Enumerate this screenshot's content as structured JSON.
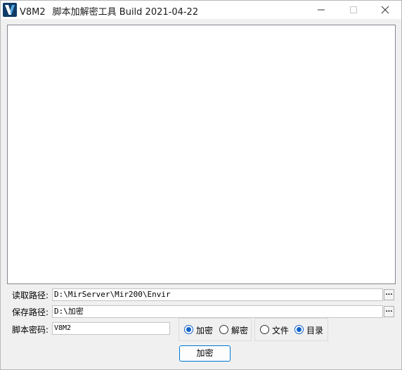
{
  "window": {
    "app_name": "V8M2",
    "title": "脚本加解密工具 Build 2021-04-22",
    "icon_letter": "V"
  },
  "fields": {
    "read_path": {
      "label": "读取路径:",
      "value": "D:\\MirServer\\Mir200\\Envir",
      "browse_label": "..."
    },
    "save_path": {
      "label": "保存路径:",
      "value": "D:\\加密",
      "browse_label": "..."
    },
    "script_password": {
      "label": "脚本密码:",
      "value": "V8M2"
    }
  },
  "mode": {
    "options": [
      {
        "label": "加密",
        "checked": true
      },
      {
        "label": "解密",
        "checked": false
      }
    ]
  },
  "target": {
    "options": [
      {
        "label": "文件",
        "checked": false
      },
      {
        "label": "目录",
        "checked": true
      }
    ]
  },
  "action": {
    "label": "加密"
  },
  "colors": {
    "accent": "#0f62c7",
    "button_border": "#0078d7",
    "icon_bg": "#0f3b66"
  },
  "icons": {
    "app": "v-logo-icon",
    "minimize": "minimize-icon",
    "maximize": "maximize-icon",
    "close": "close-icon"
  }
}
